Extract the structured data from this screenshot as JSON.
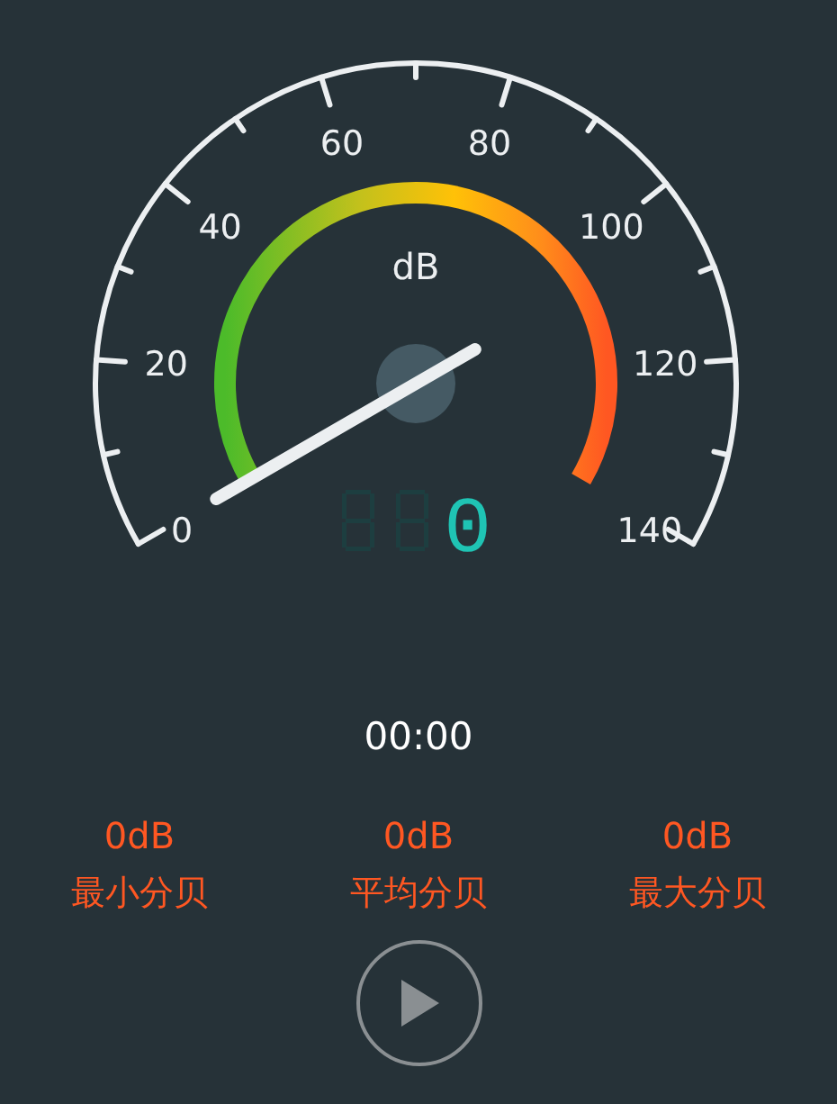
{
  "gauge": {
    "unit": "dB",
    "scale_labels": [
      "0",
      "20",
      "40",
      "60",
      "80",
      "100",
      "120",
      "140"
    ],
    "display": "0"
  },
  "timer": "00:00",
  "stats": [
    {
      "value": "0dB",
      "label": "最小分贝"
    },
    {
      "value": "0dB",
      "label": "平均分贝"
    },
    {
      "value": "0dB",
      "label": "最大分贝"
    }
  ]
}
